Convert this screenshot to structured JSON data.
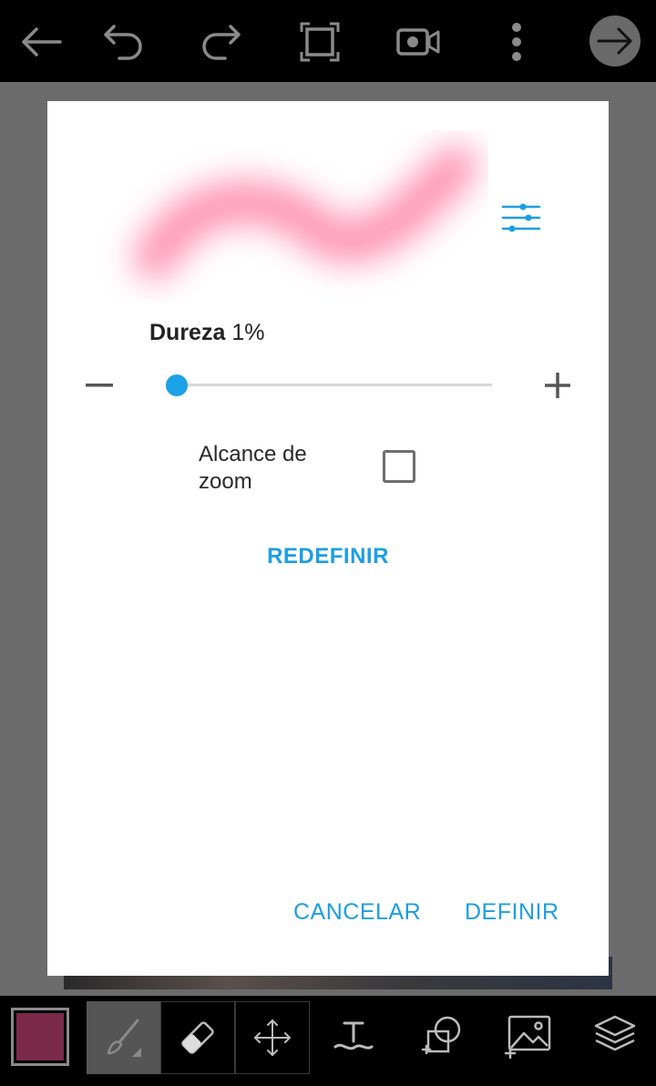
{
  "colors": {
    "accent": "#1c9ee3",
    "slider_thumb": "#1ba2e6",
    "brush_color": "#7a2a48",
    "preview_stroke": "#ff8fb3"
  },
  "topbar": {
    "icons": [
      "back-arrow-icon",
      "undo-icon",
      "redo-icon",
      "crop-icon",
      "video-record-icon",
      "more-vert-icon",
      "next-arrow-icon"
    ]
  },
  "dialog": {
    "hardness_label": "Dureza",
    "hardness_value": "1%",
    "hardness_percent": 1,
    "zoom_range_label": "Alcance de zoom",
    "zoom_range_checked": false,
    "reset_label": "REDEFINIR",
    "cancel_label": "CANCELAR",
    "set_label": "DEFINIR"
  },
  "bottombar": {
    "tools": [
      "brush-icon",
      "eraser-icon",
      "move-icon",
      "text-icon",
      "shape-icon",
      "add-image-icon",
      "layers-icon"
    ],
    "active_tool": "brush-icon"
  }
}
